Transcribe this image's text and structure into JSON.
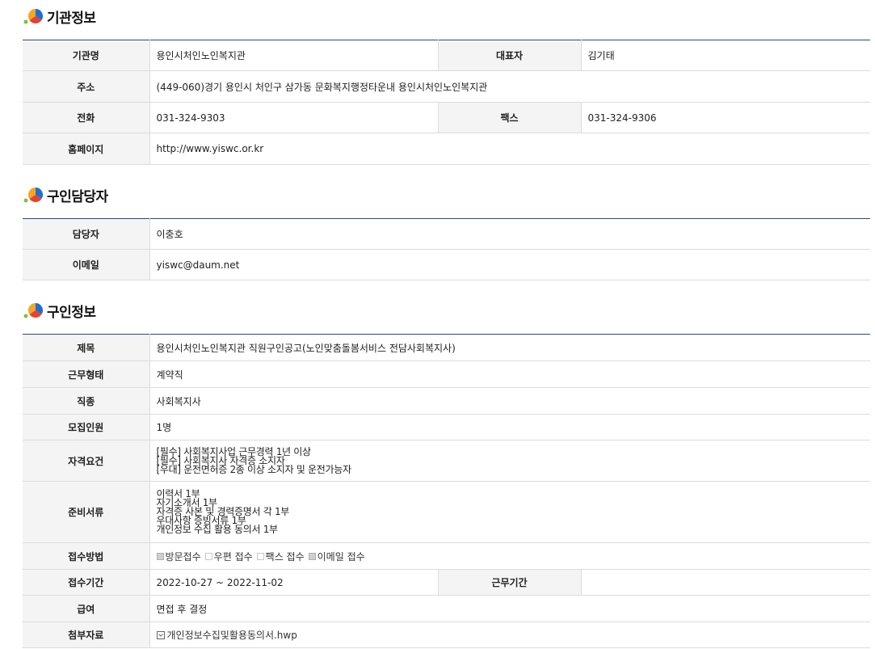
{
  "sections": {
    "org": {
      "title": "기관정보",
      "rows": {
        "name_label": "기관명",
        "name_value": "용인시처인노인복지관",
        "rep_label": "대표자",
        "rep_value": "김기태",
        "addr_label": "주소",
        "addr_value": "(449-060)경기 용인시 처인구 삼가동 문화복지행정타운내 용인시처인노인복지관",
        "phone_label": "전화",
        "phone_value": "031-324-9303",
        "fax_label": "팩스",
        "fax_value": "031-324-9306",
        "home_label": "홈페이지",
        "home_value": "http://www.yiswc.or.kr"
      }
    },
    "contact": {
      "title": "구인담당자",
      "rows": {
        "person_label": "담당자",
        "person_value": "이충호",
        "email_label": "이메일",
        "email_value": "yiswc@daum.net"
      }
    },
    "job": {
      "title": "구인정보",
      "rows": {
        "subject_label": "제목",
        "subject_value": "용인시처인노인복지관 직원구인공고(노인맞춤돌봄서비스 전담사회복지사)",
        "worktype_label": "근무형태",
        "worktype_value": "계약직",
        "jobtype_label": "직종",
        "jobtype_value": "사회복지사",
        "count_label": "모집인원",
        "count_value": "1명",
        "qual_label": "자격요건",
        "qual_lines": [
          "[필수] 사회복지사업 근무경력 1년 이상",
          "[필수] 사회복지사 자격증 소지자",
          "[우대] 운전면허증 2종 이상 소지자 및 운전가능자"
        ],
        "docs_label": "준비서류",
        "docs_lines": [
          "이력서 1부",
          "자기소개서 1부",
          "자격증 사본 및 경력증명서 각 1부",
          "우대사항 증빙서류 1부",
          "개인정보 수집 활용 동의서 1부"
        ],
        "method_label": "접수방법",
        "methods": [
          {
            "label": "방문접수",
            "checked": true
          },
          {
            "label": "우편 접수",
            "checked": false
          },
          {
            "label": "팩스 접수",
            "checked": false
          },
          {
            "label": "이메일 접수",
            "checked": true
          }
        ],
        "period_label": "접수기간",
        "period_value": "2022-10-27 ~ 2022-11-02",
        "workperiod_label": "근무기간",
        "workperiod_value": "",
        "salary_label": "급여",
        "salary_value": "면접 후 결정",
        "attach_label": "첨부자료",
        "attach_value": "개인정보수집및활용동의서.hwp"
      }
    }
  }
}
